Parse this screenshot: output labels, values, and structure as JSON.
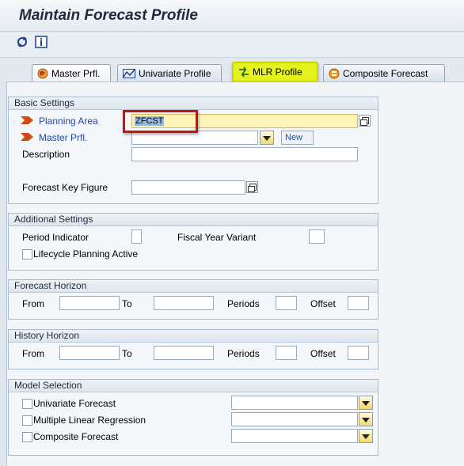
{
  "window": {
    "title": "Maintain Forecast Profile"
  },
  "toolbar": {
    "icons": [
      "refresh-icon",
      "info-icon"
    ]
  },
  "tabs": [
    {
      "label": "Master Prfl.",
      "icon": "globe-icon"
    },
    {
      "label": "Univariate Profile",
      "icon": "graph-icon"
    },
    {
      "label": "MLR Profile",
      "icon": "arrows-icon"
    },
    {
      "label": "Composite Forecast",
      "icon": "composite-icon"
    }
  ],
  "basic_settings": {
    "header": "Basic Settings",
    "planning_area_label": "Planning Area",
    "planning_area_value": "ZFCST",
    "master_prfl_label": "Master Prfl.",
    "master_prfl_value": "",
    "new_label": "New",
    "description_label": "Description",
    "description_value": "",
    "key_figure_label": "Forecast Key Figure",
    "key_figure_value": ""
  },
  "additional_settings": {
    "header": "Additional Settings",
    "period_indicator_label": "Period Indicator",
    "period_indicator_value": "",
    "fy_variant_label": "Fiscal Year Variant",
    "fy_variant_value": "",
    "lifecycle_label": "Lifecycle Planning Active",
    "lifecycle_checked": false
  },
  "forecast_horizon": {
    "header": "Forecast Horizon",
    "from_label": "From",
    "from_value": "",
    "to_label": "To",
    "to_value": "",
    "periods_label": "Periods",
    "periods_value": "",
    "offset_label": "Offset",
    "offset_value": ""
  },
  "history_horizon": {
    "header": "History Horizon",
    "from_label": "From",
    "from_value": "",
    "to_label": "To",
    "to_value": "",
    "periods_label": "Periods",
    "periods_value": "",
    "offset_label": "Offset",
    "offset_value": ""
  },
  "model_selection": {
    "header": "Model Selection",
    "items": [
      {
        "label": "Univariate Forecast",
        "checked": false,
        "value": ""
      },
      {
        "label": "Multiple Linear Regression",
        "checked": false,
        "value": ""
      },
      {
        "label": "Composite Forecast",
        "checked": false,
        "value": ""
      }
    ]
  },
  "colors": {
    "accent_highlight": "#e4f21e",
    "annotation_box": "#d01010",
    "required_label": "#2244aa"
  }
}
